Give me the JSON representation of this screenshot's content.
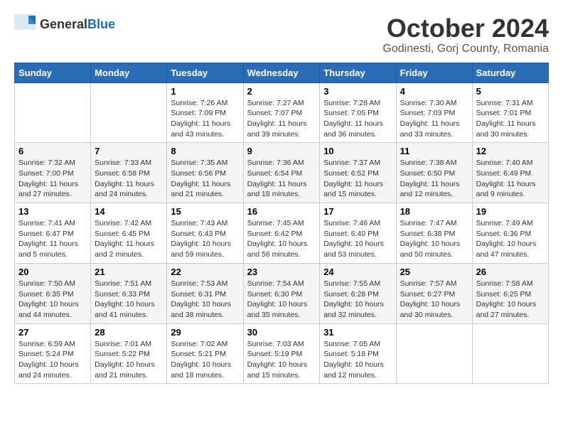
{
  "logo": {
    "general": "General",
    "blue": "Blue"
  },
  "title": "October 2024",
  "location": "Godinesti, Gorj County, Romania",
  "days_header": [
    "Sunday",
    "Monday",
    "Tuesday",
    "Wednesday",
    "Thursday",
    "Friday",
    "Saturday"
  ],
  "weeks": [
    [
      {
        "day": "",
        "info": ""
      },
      {
        "day": "",
        "info": ""
      },
      {
        "day": "1",
        "info": "Sunrise: 7:26 AM\nSunset: 7:09 PM\nDaylight: 11 hours and 43 minutes."
      },
      {
        "day": "2",
        "info": "Sunrise: 7:27 AM\nSunset: 7:07 PM\nDaylight: 11 hours and 39 minutes."
      },
      {
        "day": "3",
        "info": "Sunrise: 7:28 AM\nSunset: 7:05 PM\nDaylight: 11 hours and 36 minutes."
      },
      {
        "day": "4",
        "info": "Sunrise: 7:30 AM\nSunset: 7:03 PM\nDaylight: 11 hours and 33 minutes."
      },
      {
        "day": "5",
        "info": "Sunrise: 7:31 AM\nSunset: 7:01 PM\nDaylight: 11 hours and 30 minutes."
      }
    ],
    [
      {
        "day": "6",
        "info": "Sunrise: 7:32 AM\nSunset: 7:00 PM\nDaylight: 11 hours and 27 minutes."
      },
      {
        "day": "7",
        "info": "Sunrise: 7:33 AM\nSunset: 6:58 PM\nDaylight: 11 hours and 24 minutes."
      },
      {
        "day": "8",
        "info": "Sunrise: 7:35 AM\nSunset: 6:56 PM\nDaylight: 11 hours and 21 minutes."
      },
      {
        "day": "9",
        "info": "Sunrise: 7:36 AM\nSunset: 6:54 PM\nDaylight: 11 hours and 18 minutes."
      },
      {
        "day": "10",
        "info": "Sunrise: 7:37 AM\nSunset: 6:52 PM\nDaylight: 11 hours and 15 minutes."
      },
      {
        "day": "11",
        "info": "Sunrise: 7:38 AM\nSunset: 6:50 PM\nDaylight: 11 hours and 12 minutes."
      },
      {
        "day": "12",
        "info": "Sunrise: 7:40 AM\nSunset: 6:49 PM\nDaylight: 11 hours and 9 minutes."
      }
    ],
    [
      {
        "day": "13",
        "info": "Sunrise: 7:41 AM\nSunset: 6:47 PM\nDaylight: 11 hours and 5 minutes."
      },
      {
        "day": "14",
        "info": "Sunrise: 7:42 AM\nSunset: 6:45 PM\nDaylight: 11 hours and 2 minutes."
      },
      {
        "day": "15",
        "info": "Sunrise: 7:43 AM\nSunset: 6:43 PM\nDaylight: 10 hours and 59 minutes."
      },
      {
        "day": "16",
        "info": "Sunrise: 7:45 AM\nSunset: 6:42 PM\nDaylight: 10 hours and 56 minutes."
      },
      {
        "day": "17",
        "info": "Sunrise: 7:46 AM\nSunset: 6:40 PM\nDaylight: 10 hours and 53 minutes."
      },
      {
        "day": "18",
        "info": "Sunrise: 7:47 AM\nSunset: 6:38 PM\nDaylight: 10 hours and 50 minutes."
      },
      {
        "day": "19",
        "info": "Sunrise: 7:49 AM\nSunset: 6:36 PM\nDaylight: 10 hours and 47 minutes."
      }
    ],
    [
      {
        "day": "20",
        "info": "Sunrise: 7:50 AM\nSunset: 6:35 PM\nDaylight: 10 hours and 44 minutes."
      },
      {
        "day": "21",
        "info": "Sunrise: 7:51 AM\nSunset: 6:33 PM\nDaylight: 10 hours and 41 minutes."
      },
      {
        "day": "22",
        "info": "Sunrise: 7:53 AM\nSunset: 6:31 PM\nDaylight: 10 hours and 38 minutes."
      },
      {
        "day": "23",
        "info": "Sunrise: 7:54 AM\nSunset: 6:30 PM\nDaylight: 10 hours and 35 minutes."
      },
      {
        "day": "24",
        "info": "Sunrise: 7:55 AM\nSunset: 6:28 PM\nDaylight: 10 hours and 32 minutes."
      },
      {
        "day": "25",
        "info": "Sunrise: 7:57 AM\nSunset: 6:27 PM\nDaylight: 10 hours and 30 minutes."
      },
      {
        "day": "26",
        "info": "Sunrise: 7:58 AM\nSunset: 6:25 PM\nDaylight: 10 hours and 27 minutes."
      }
    ],
    [
      {
        "day": "27",
        "info": "Sunrise: 6:59 AM\nSunset: 5:24 PM\nDaylight: 10 hours and 24 minutes."
      },
      {
        "day": "28",
        "info": "Sunrise: 7:01 AM\nSunset: 5:22 PM\nDaylight: 10 hours and 21 minutes."
      },
      {
        "day": "29",
        "info": "Sunrise: 7:02 AM\nSunset: 5:21 PM\nDaylight: 10 hours and 18 minutes."
      },
      {
        "day": "30",
        "info": "Sunrise: 7:03 AM\nSunset: 5:19 PM\nDaylight: 10 hours and 15 minutes."
      },
      {
        "day": "31",
        "info": "Sunrise: 7:05 AM\nSunset: 5:18 PM\nDaylight: 10 hours and 12 minutes."
      },
      {
        "day": "",
        "info": ""
      },
      {
        "day": "",
        "info": ""
      }
    ]
  ]
}
